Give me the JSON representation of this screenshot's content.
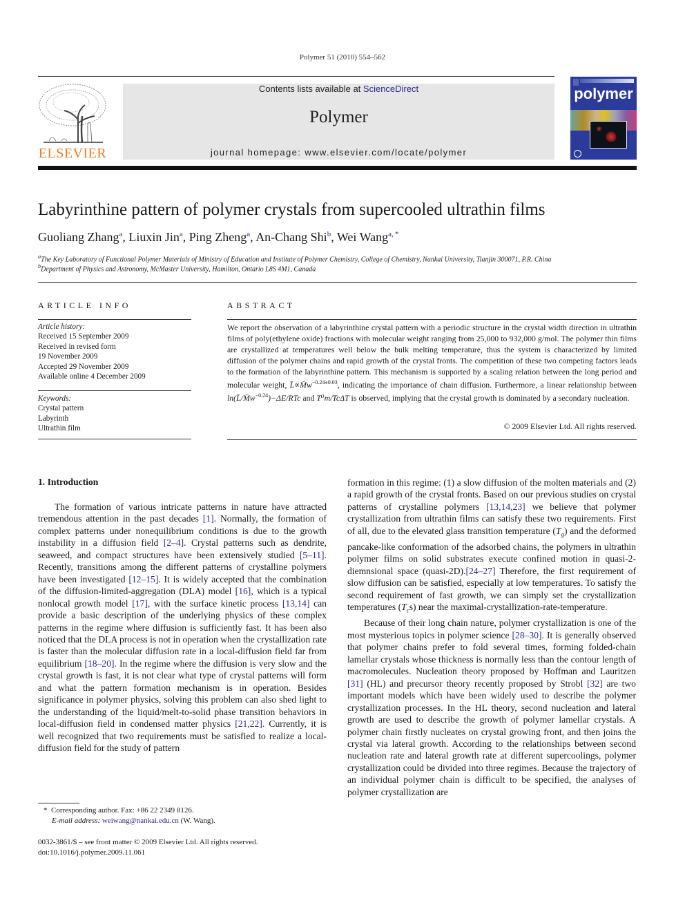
{
  "header": {
    "running_head": "Polymer 51 (2010) 554–562",
    "contents_prefix": "Contents lists available at ",
    "contents_link": "ScienceDirect",
    "journal_name": "Polymer",
    "homepage_prefix": "journal homepage: ",
    "homepage_url": "www.elsevier.com/locate/polymer",
    "publisher_logo_text": "ELSEVIER",
    "cover_title": "polymer",
    "colors": {
      "elsevier_orange": "#f07b1e",
      "link_blue": "#2b2b8c",
      "cover_blue": "#2a3b9c",
      "masthead_gray": "#e6e6e6"
    }
  },
  "article": {
    "title": "Labyrinthine pattern of polymer crystals from supercooled ultrathin films",
    "authors": [
      {
        "name": "Guoliang Zhang",
        "aff": "a"
      },
      {
        "name": "Liuxin Jin",
        "aff": "a"
      },
      {
        "name": "Ping Zheng",
        "aff": "a"
      },
      {
        "name": "An-Chang Shi",
        "aff": "b"
      },
      {
        "name": "Wei Wang",
        "aff": "a, *"
      }
    ],
    "affiliations": [
      {
        "mark": "a",
        "text": "The Key Laboratory of Functional Polymer Materials of Ministry of Education and Institute of Polymer Chemistry, College of Chemistry, Nankai University, Tianjin 300071, P.R. China"
      },
      {
        "mark": "b",
        "text": "Department of Physics and Astronomy, McMaster University, Hamilton, Ontario L8S 4M1, Canada"
      }
    ]
  },
  "article_info": {
    "heading": "ARTICLE INFO",
    "history_label": "Article history:",
    "history": [
      "Received 15 September 2009",
      "Received in revised form",
      "19 November 2009",
      "Accepted 29 November 2009",
      "Available online 4 December 2009"
    ],
    "keywords_label": "Keywords:",
    "keywords": [
      "Crystal pattern",
      "Labyrinth",
      "Ultrathin film"
    ]
  },
  "abstract": {
    "heading": "ABSTRACT",
    "part1": "We report the observation of a labyrinthine crystal pattern with a periodic structure in the crystal width direction in ultrathin films of poly(ethylene oxide) fractions with molecular weight ranging from 25,000 to 932,000 g/mol. The polymer thin films are crystallized at temperatures well below the bulk melting temperature, thus the system is characterized by limited diffusion of the polymer chains and rapid growth of the crystal fronts. The competition of these two competing factors leads to the formation of the labyrinthine pattern. This mechanism is supported by a scaling relation between the long period and molecular weight, ",
    "eq1": "L̄∝M̄w",
    "eq1_exp": "−0.24±0.03",
    "part2": ", indicating the importance of chain diffusion. Furthermore, a linear relationship between ",
    "eq2": "ln(L̄/M̄w",
    "eq2_exp": "−0.24",
    "eq2_tail": ")−ΔE/RTc",
    "part3": " and ",
    "eq3": "T⁰m/TcΔT",
    "part4": " is observed, implying that the crystal growth is dominated by a secondary nucleation.",
    "copyright": "© 2009 Elsevier Ltd. All rights reserved."
  },
  "body": {
    "section_heading": "1.  Introduction",
    "left_col": [
      {
        "t": "The formation of various intricate patterns in nature have attracted tremendous attention in the past decades "
      },
      {
        "r": "[1]"
      },
      {
        "t": ". Normally, the formation of complex patterns under nonequilibrium conditions is due to the growth instability in a diffusion field "
      },
      {
        "r": "[2–4]"
      },
      {
        "t": ". Crystal patterns such as dendrite, seaweed, and compact structures have been extensively studied "
      },
      {
        "r": "[5–11]"
      },
      {
        "t": ". Recently, transitions among the different patterns of crystalline polymers have been investigated "
      },
      {
        "r": "[12–15]"
      },
      {
        "t": ". It is widely accepted that the combination of the diffusion-limited-aggregation (DLA) model "
      },
      {
        "r": "[16]"
      },
      {
        "t": ", which is a typical nonlocal growth model "
      },
      {
        "r": "[17]"
      },
      {
        "t": ", with the surface kinetic process "
      },
      {
        "r": "[13,14]"
      },
      {
        "t": " can provide a basic description of the underlying physics of these complex patterns in the regime where diffusion is sufficiently fast. It has been also noticed that the DLA process is not in operation when the crystallization rate is faster than the molecular diffusion rate in a local-diffusion field far from equilibrium "
      },
      {
        "r": "[18–20]"
      },
      {
        "t": ". In the regime where the diffusion is very slow and the crystal growth is fast, it is not clear what type of crystal patterns will form and what the pattern formation mechanism is in operation. Besides significance in polymer physics, solving this problem can also shed light to the understanding of the liquid/melt-to-solid phase transition behaviors in local-diffusion field in condensed matter physics "
      },
      {
        "r": "[21,22]"
      },
      {
        "t": ". Currently, it is well recognized that two requirements must be satisfied to realize a local-diffusion field for the study of pattern"
      }
    ],
    "right_col_p1": [
      {
        "t": "formation in this regime: (1) a slow diffusion of the molten materials and (2) a rapid growth of the crystal fronts. Based on our previous studies on crystal patterns of crystalline polymers "
      },
      {
        "r": "[13,14,23]"
      },
      {
        "t": " we believe that polymer crystallization from ultrathin films can satisfy these two requirements. First of all, due to the elevated glass transition temperature ("
      },
      {
        "i": "T",
        "sub": "g"
      },
      {
        "t": ") and the deformed pancake-like conformation of the adsorbed chains, the polymers in ultrathin polymer films on solid substrates execute confined motion in quasi-2-diemnsional space (quasi-2D)."
      },
      {
        "r": "[24–27]"
      },
      {
        "t": " Therefore, the first requirement of slow diffusion can be satisfied, especially at low temperatures. To satisfy the second requirement of fast growth, we can simply set the crystallization temperatures ("
      },
      {
        "i": "T",
        "sub": "c"
      },
      {
        "t": "s) near the maximal-crystallization-rate-temperature."
      }
    ],
    "right_col_p2": [
      {
        "t": "Because of their long chain nature, polymer crystallization is one of the most mysterious topics in polymer science "
      },
      {
        "r": "[28–30]"
      },
      {
        "t": ". It is generally observed that polymer chains prefer to fold several times, forming folded-chain lamellar crystals whose thickness is normally less than the contour length of macromolecules. Nucleation theory proposed by Hoffman and Lauritzen "
      },
      {
        "r": "[31]"
      },
      {
        "t": " (HL) and precursor theory recently proposed by Strobl "
      },
      {
        "r": "[32]"
      },
      {
        "t": " are two important models which have been widely used to describe the polymer crystallization processes. In the HL theory, second nucleation and lateral growth are used to describe the growth of polymer lamellar crystals. A polymer chain firstly nucleates on crystal growing front, and then joins the crystal via lateral growth. According to the relationships between second nucleation rate and lateral growth rate at different supercoolings, polymer crystallization could be divided into three regimes. Because the trajectory of an individual polymer chain is difficult to be specified, the analyses of polymer crystallization are"
      }
    ]
  },
  "footnote": {
    "mark": "*",
    "corresponding": "Corresponding author. Fax: +86 22 2349 8126.",
    "email_label": "E-mail address: ",
    "email": "weiwang@nankai.edu.cn",
    "email_suffix": " (W. Wang)."
  },
  "front_matter": {
    "issn_line": "0032-3861/$ – see front matter © 2009 Elsevier Ltd. All rights reserved.",
    "doi": "doi:10.1016/j.polymer.2009.11.061"
  }
}
